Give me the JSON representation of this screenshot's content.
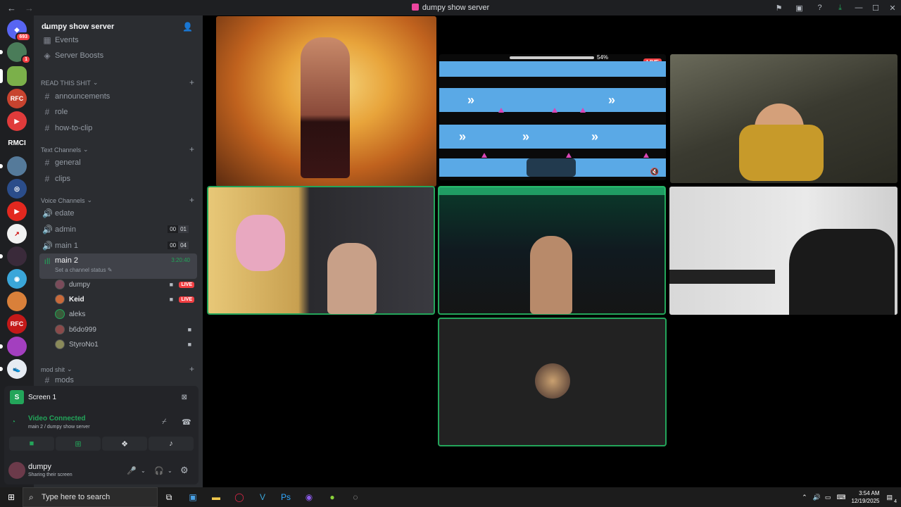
{
  "window": {
    "title": "dumpy show server",
    "back": "←",
    "forward": "→"
  },
  "titlebar_icons": [
    "inbox-icon",
    "screen-icon",
    "help-icon",
    "download-icon"
  ],
  "window_controls": {
    "minimize": "—",
    "maximize": "☐",
    "close": "✕"
  },
  "guilds": {
    "home_badge": "693",
    "badge2": "1",
    "text_server": "RMCI"
  },
  "server": {
    "name": "dumpy show server",
    "chevron": "⌄"
  },
  "top_items": [
    {
      "label": "Events"
    },
    {
      "label": "Server Boosts"
    }
  ],
  "categories": {
    "read": "READ THIS SHIT",
    "text": "Text Channels",
    "voice": "Voice Channels",
    "mod": "mod shit"
  },
  "read_channels": [
    "announcements",
    "role",
    "how-to-clip"
  ],
  "text_channels": [
    "general",
    "clips"
  ],
  "voice_channels": [
    {
      "name": "edate"
    },
    {
      "name": "admin",
      "c1": "00",
      "c2": "01"
    },
    {
      "name": "main 1",
      "c1": "00",
      "c2": "04"
    }
  ],
  "active_channel": {
    "name": "main 2",
    "status": "Set a channel status",
    "timer": "3:20:40"
  },
  "voice_users": [
    {
      "name": "dumpy",
      "live": "LIVE"
    },
    {
      "name": "Keid",
      "live": "LIVE"
    },
    {
      "name": "aleks"
    },
    {
      "name": "b6do999"
    },
    {
      "name": "StyroNo1"
    }
  ],
  "mod_channel": "mods",
  "voice_panel": {
    "screen_label": "Screen 1",
    "connected": "Video Connected",
    "location": "main 2 / dumpy show server"
  },
  "user": {
    "name": "dumpy",
    "status": "Sharing their screen"
  },
  "stage": {
    "live_label": "LIVE",
    "progress_text": "54%"
  },
  "taskbar": {
    "search_placeholder": "Type here to search",
    "time": "3:54 AM",
    "date": "12/19/2025",
    "notif_count": "4"
  },
  "colors": {
    "accent_green": "#23a55a",
    "live_red": "#f23f43",
    "sidebar": "#2b2d31"
  }
}
